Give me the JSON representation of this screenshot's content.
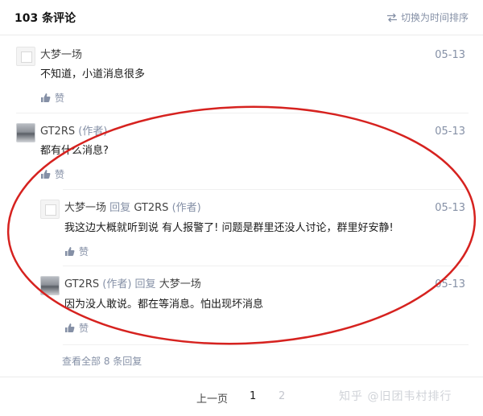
{
  "header": {
    "count_label": "103 条评论",
    "sort_label": "切换为时间排序"
  },
  "comments": [
    {
      "author": "大梦一场",
      "date": "05-13",
      "text": "不知道，小道消息很多",
      "like_label": "赞"
    },
    {
      "author": "GT2RS",
      "tag": "(作者)",
      "date": "05-13",
      "text": "都有什么消息?",
      "like_label": "赞"
    }
  ],
  "replies": [
    {
      "author": "大梦一场",
      "reply_word": "回复",
      "reply_to": "GT2RS",
      "reply_to_tag": "(作者)",
      "date": "05-13",
      "text": "我这边大概就听到说 有人报警了! 问题是群里还没人讨论，群里好安静!",
      "like_label": "赞"
    },
    {
      "author": "GT2RS",
      "tag": "(作者)",
      "reply_word": "回复",
      "reply_to": "大梦一场",
      "date": "05-13",
      "text": "因为没人敢说。都在等消息。怕出现坏消息",
      "like_label": "赞"
    }
  ],
  "view_all_label": "查看全部 8 条回复",
  "pagination": {
    "prev_label": "上一页",
    "page1": "1",
    "page2": "2"
  },
  "watermark": "知乎 @旧团韦村排行",
  "colors": {
    "annotation": "#d6221f",
    "muted": "#8590a6"
  }
}
